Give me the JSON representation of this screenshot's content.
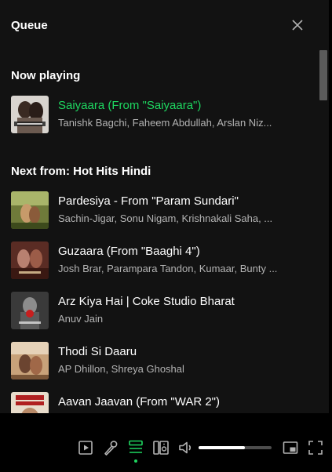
{
  "queue": {
    "title": "Queue",
    "close_icon": "close-icon",
    "now_playing_heading": "Now playing",
    "now_playing": {
      "title": "Saiyaara (From \"Saiyaara\")",
      "artists": "Tanishk Bagchi, Faheem Abdullah, Arslan Niz...",
      "status_color": "#1ed760"
    },
    "next_heading": "Next from: Hot Hits Hindi",
    "next_tracks": [
      {
        "title": "Pardesiya - From \"Param Sundari\"",
        "artists": "Sachin-Jigar, Sonu Nigam, Krishnakali Saha, ..."
      },
      {
        "title": "Guzaara (From \"Baaghi 4\")",
        "artists": "Josh Brar, Parampara Tandon, Kumaar, Bunty ..."
      },
      {
        "title": "Arz Kiya Hai | Coke Studio Bharat",
        "artists": "Anuv Jain"
      },
      {
        "title": "Thodi Si Daaru",
        "artists": "AP Dhillon, Shreya Ghoshal"
      },
      {
        "title": "Aavan Jaavan (From \"WAR 2\")",
        "artists": ""
      }
    ]
  },
  "controls": {
    "icons": [
      "now-playing-view-icon",
      "lyrics-icon",
      "queue-icon",
      "connect-device-icon",
      "volume-icon",
      "miniplayer-icon",
      "fullscreen-icon"
    ],
    "queue_active": true,
    "volume_level": 0.63,
    "accent_color": "#1ed760"
  }
}
